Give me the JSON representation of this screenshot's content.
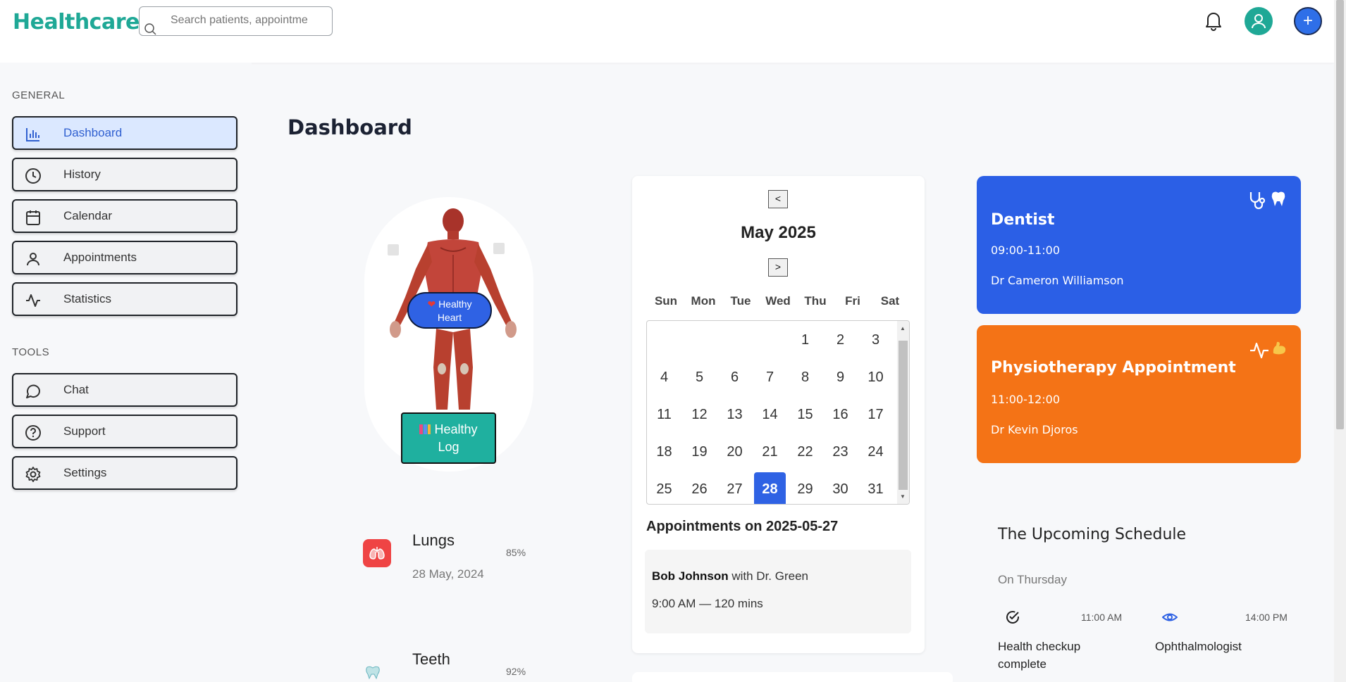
{
  "header": {
    "logo": "Healthcare.",
    "search_placeholder": "Search patients, appointme"
  },
  "sidebar": {
    "general_label": "GENERAL",
    "tools_label": "TOOLS",
    "general_items": [
      {
        "label": "Dashboard",
        "icon": "bar-chart-icon",
        "active": true
      },
      {
        "label": "History",
        "icon": "clock-icon"
      },
      {
        "label": "Calendar",
        "icon": "calendar-icon"
      },
      {
        "label": "Appointments",
        "icon": "user-icon"
      },
      {
        "label": "Statistics",
        "icon": "activity-icon"
      }
    ],
    "tool_items": [
      {
        "label": "Chat",
        "icon": "chat-icon"
      },
      {
        "label": "Support",
        "icon": "help-icon"
      },
      {
        "label": "Settings",
        "icon": "gear-icon"
      }
    ]
  },
  "page": {
    "title": "Dashboard"
  },
  "body_card": {
    "heart_badge": "Healthy Heart",
    "heart_badge_line1": "Healthy",
    "heart_badge_line2": "Heart",
    "log_line1": "Healthy",
    "log_line2": "Log",
    "organs": [
      {
        "name": "Lungs",
        "percent": "85%",
        "date": "28 May, 2024",
        "icon": "lungs-icon"
      },
      {
        "name": "Teeth",
        "percent": "92%",
        "icon": "tooth-icon"
      }
    ]
  },
  "calendar": {
    "prev_label": "<",
    "next_label": ">",
    "month": "May 2025",
    "weekdays": [
      "Sun",
      "Mon",
      "Tue",
      "Wed",
      "Thu",
      "Fri",
      "Sat"
    ],
    "selected_day": "28",
    "appointments_title": "Appointments on 2025-05-27",
    "appointment": {
      "patient": "Bob Johnson",
      "with": "with Dr. Green",
      "time": "9:00 AM — 120 mins"
    }
  },
  "cards": [
    {
      "title": "Dentist",
      "time": "09:00-11:00",
      "doctor": "Dr Cameron Williamson",
      "color": "#2b5fe6",
      "icons": [
        "stethoscope-icon",
        "tooth-icon"
      ]
    },
    {
      "title": "Physiotherapy Appointment",
      "time": "11:00-12:00",
      "doctor": "Dr Kevin Djoros",
      "color": "#f47316",
      "icons": [
        "activity-icon",
        "muscle-icon"
      ]
    }
  ],
  "schedule": {
    "title": "The Upcoming Schedule",
    "day": "On Thursday",
    "items": [
      {
        "time": "11:00 AM",
        "label_line1": "Health checkup",
        "label_line2": "complete",
        "icon": "check-circle-icon"
      },
      {
        "time": "14:00 PM",
        "label_line1": "Ophthalmologist",
        "label_line2": "",
        "icon": "eye-icon"
      }
    ]
  },
  "colors": {
    "brand": "#1fa896",
    "accent": "#2f62e4",
    "orange": "#f47316"
  }
}
